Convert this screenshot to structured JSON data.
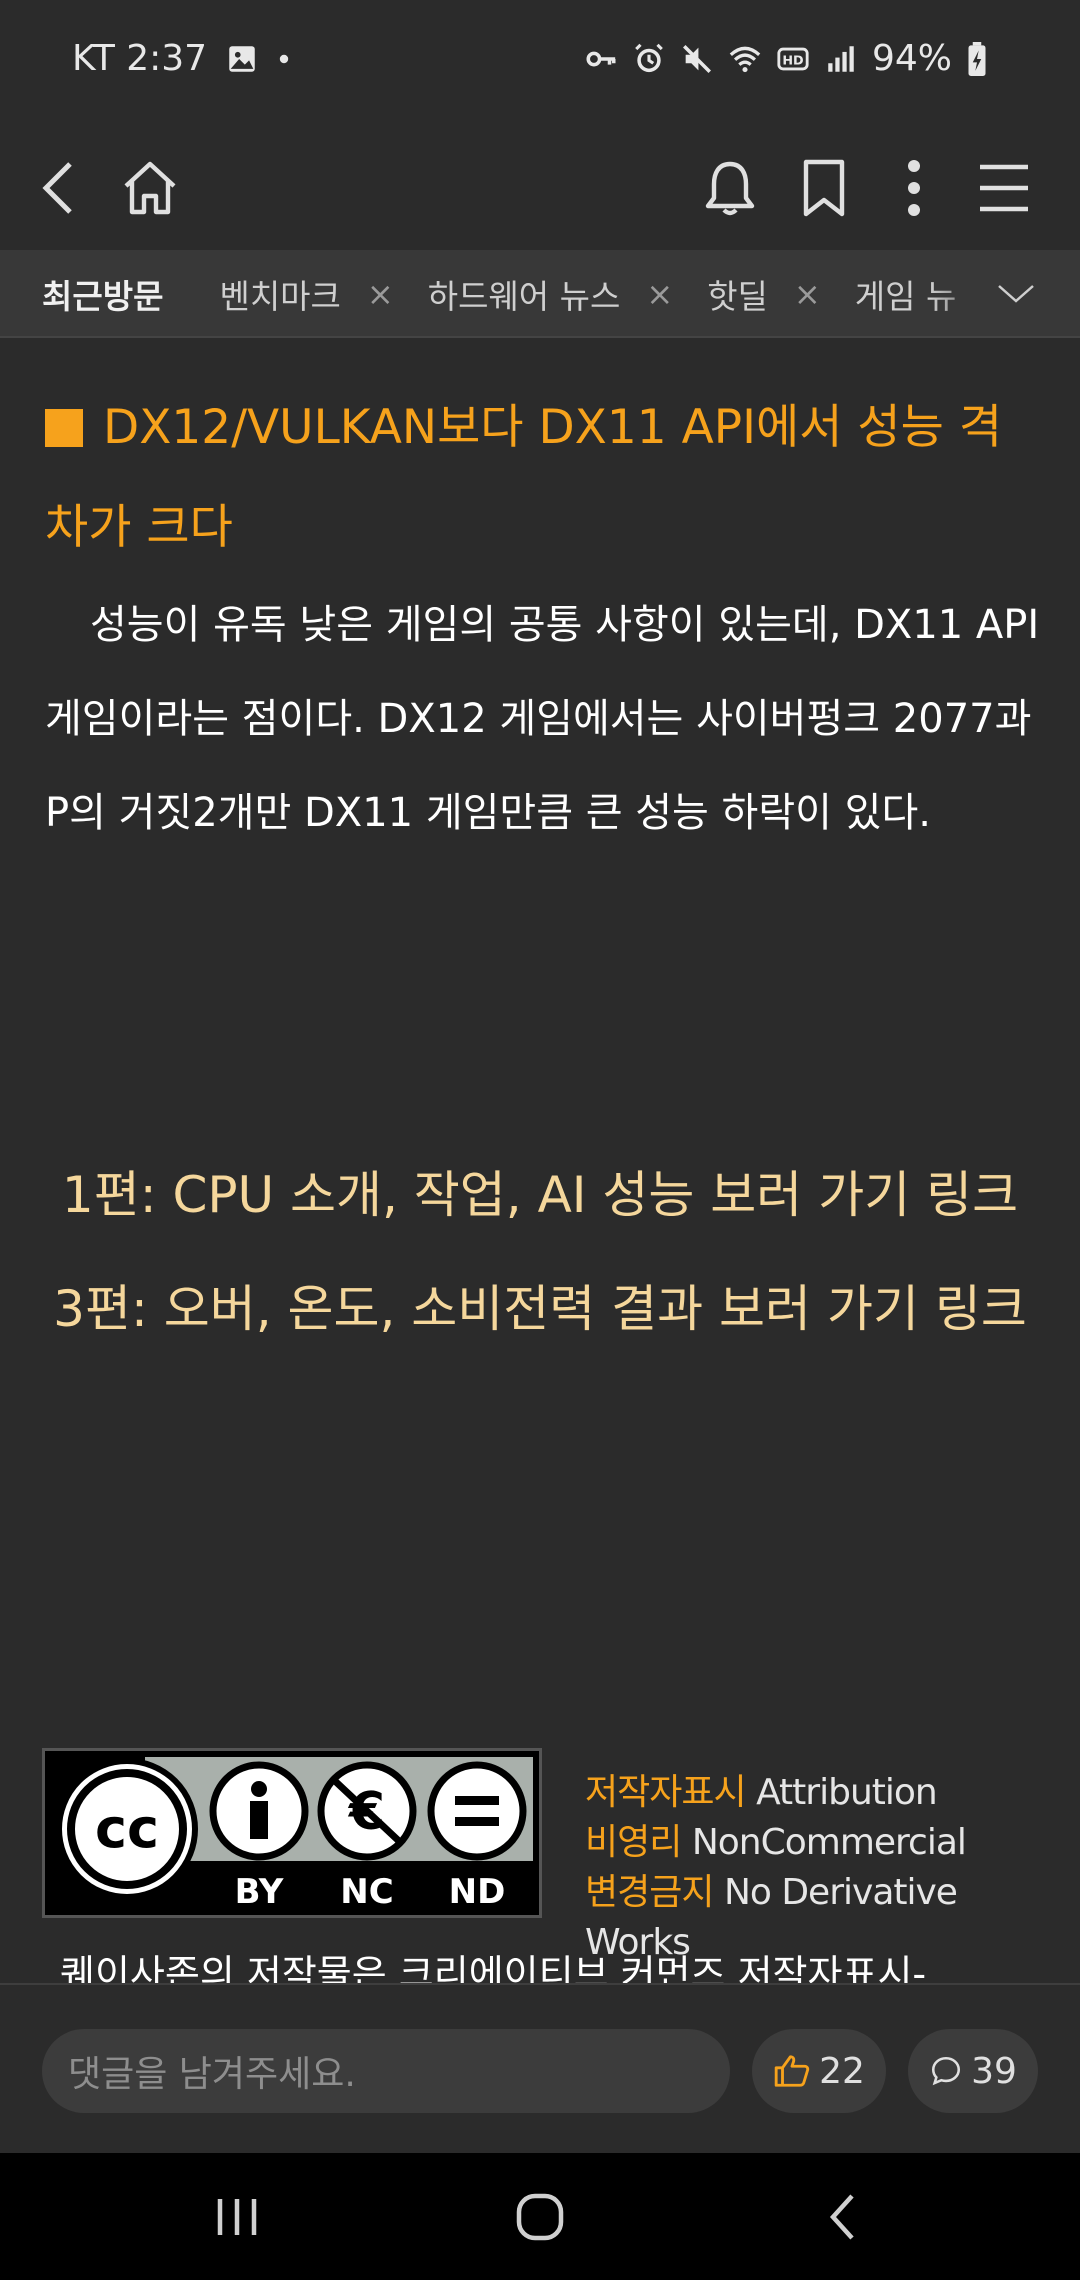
{
  "status_bar": {
    "carrier_time": "KT 2:37",
    "battery": "94%",
    "icons": [
      "gallery-icon",
      "dot-icon",
      "key-icon",
      "alarm-icon",
      "mute-icon",
      "wifi-icon",
      "hd-icon",
      "signal-icon",
      "battery-charging-icon"
    ]
  },
  "nav": {
    "icons": [
      "back-icon",
      "home-icon",
      "bell-icon",
      "bookmark-icon",
      "more-vertical-icon",
      "menu-icon"
    ]
  },
  "tabs": {
    "active": "최근방문",
    "items": [
      {
        "label": "벤치마크"
      },
      {
        "label": "하드웨어 뉴스"
      },
      {
        "label": "핫딜"
      },
      {
        "label": "게임 뉴"
      }
    ]
  },
  "article": {
    "heading": "DX12/VULKAN보다 DX11 API에서 성능 격차가 크다",
    "paragraph": "성능이 유독 낮은 게임의 공통 사항이 있는데, DX11 API 게임이라는 점이다. DX12 게임에서는 사이버펑크 2077과 P의 거짓2개만 DX11 게임만큼 큰 성능 하락이 있다.",
    "link1": "1편: CPU 소개, 작업, AI 성능 보러 가기 링크",
    "link2": "3편: 오버, 온도, 소비전력 결과 보러 가기 링크",
    "license": {
      "badge_cc": "cc",
      "badge_by": "BY",
      "badge_nc": "NC",
      "badge_nd": "ND",
      "line1_ko": "저작자표시",
      "line1_en": "Attribution",
      "line2_ko": "비영리",
      "line2_en": "NonCommercial",
      "line3_ko": "변경금지",
      "line3_en": "No Derivative Works"
    },
    "notice": "퀘이사존의 저작물은 크리에이티브 커먼즈 저작자표시-"
  },
  "comment_bar": {
    "placeholder": "댓글을 남겨주세요.",
    "likes": "22",
    "comments": "39"
  },
  "colors": {
    "background": "#2b2b2b",
    "accent_orange": "#f6a21c",
    "link_yellow": "#f5d79c",
    "tabbar": "#383838"
  }
}
